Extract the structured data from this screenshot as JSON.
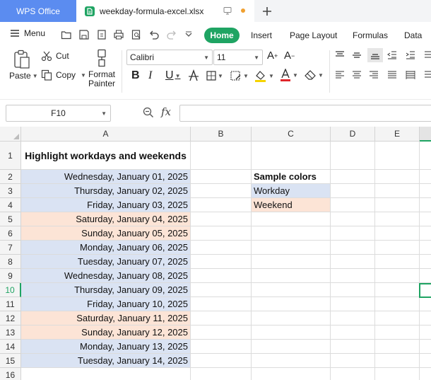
{
  "titlebar": {
    "app_tab": "WPS Office",
    "file_tab": "weekday-formula-excel.xlsx",
    "new_tab_icon": "plus-icon"
  },
  "menubar": {
    "menu_label": "Menu",
    "tabs": [
      "Home",
      "Insert",
      "Page Layout",
      "Formulas",
      "Data"
    ],
    "active_tab": "Home",
    "accent": "#1fa463"
  },
  "ribbon": {
    "paste": "Paste",
    "cut": "Cut",
    "copy": "Copy",
    "format_painter_line1": "Format",
    "format_painter_line2": "Painter",
    "font_name": "Calibri",
    "font_size": "11"
  },
  "formula_bar": {
    "name_box": "F10",
    "fx": "fx",
    "formula": ""
  },
  "sheet": {
    "columns": [
      "A",
      "B",
      "C",
      "D",
      "E"
    ],
    "rows": [
      "1",
      "2",
      "3",
      "4",
      "5",
      "6",
      "7",
      "8",
      "9",
      "10",
      "11",
      "12",
      "13",
      "14",
      "15",
      "16"
    ],
    "active_row": "10",
    "title": "Highlight workdays and weekends",
    "dates": [
      {
        "text": "Wednesday, January 01, 2025",
        "kind": "workday"
      },
      {
        "text": "Thursday, January 02, 2025",
        "kind": "workday"
      },
      {
        "text": "Friday, January 03, 2025",
        "kind": "workday"
      },
      {
        "text": "Saturday, January 04, 2025",
        "kind": "weekend"
      },
      {
        "text": "Sunday, January 05, 2025",
        "kind": "weekend"
      },
      {
        "text": "Monday, January 06, 2025",
        "kind": "workday"
      },
      {
        "text": "Tuesday, January 07, 2025",
        "kind": "workday"
      },
      {
        "text": "Wednesday, January 08, 2025",
        "kind": "workday"
      },
      {
        "text": "Thursday, January 09, 2025",
        "kind": "workday"
      },
      {
        "text": "Friday, January 10, 2025",
        "kind": "workday"
      },
      {
        "text": "Saturday, January 11, 2025",
        "kind": "weekend"
      },
      {
        "text": "Sunday, January 12, 2025",
        "kind": "weekend"
      },
      {
        "text": "Monday, January 13, 2025",
        "kind": "workday"
      },
      {
        "text": "Tuesday, January 14, 2025",
        "kind": "workday"
      }
    ],
    "legend_header": "Sample colors",
    "legend_workday": "Workday",
    "legend_weekend": "Weekend",
    "colors": {
      "workday": "#dae3f3",
      "weekend": "#fce4d6"
    }
  }
}
